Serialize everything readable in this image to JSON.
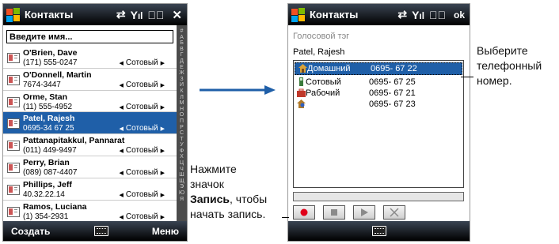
{
  "left_screen": {
    "title": "Контакты",
    "search_placeholder": "Введите имя...",
    "alpha_index": "#АБВГДЕЖЗИКЛМНОПРСТУФХЦЧШЩЭЮЯ",
    "contacts": [
      {
        "name": "O'Brien, Dave",
        "phone": "(171) 555-0247",
        "type": "Сотовый",
        "selected": false
      },
      {
        "name": "O'Donnell, Martin",
        "phone": "7674-3447",
        "type": "Сотовый",
        "selected": false
      },
      {
        "name": "Orme, Stan",
        "phone": "(11) 555-4952",
        "type": "Сотовый",
        "selected": false
      },
      {
        "name": "Patel, Rajesh",
        "phone": "0695-34 67 25",
        "type": "Сотовый",
        "selected": true
      },
      {
        "name": "Pattanapitakkul, Pannarat",
        "phone": "(011) 449-9497",
        "type": "Сотовый",
        "selected": false
      },
      {
        "name": "Perry, Brian",
        "phone": "(089) 087-4407",
        "type": "Сотовый",
        "selected": false
      },
      {
        "name": "Phillips, Jeff",
        "phone": "40.32.22.14",
        "type": "Сотовый",
        "selected": false
      },
      {
        "name": "Ramos, Luciana",
        "phone": "(1) 354-2931",
        "type": "Сотовый",
        "selected": false
      }
    ],
    "left_softkey": "Создать",
    "right_softkey": "Меню"
  },
  "right_screen": {
    "title": "Контакты",
    "ok_label": "ok",
    "voice_tag_label": "Голосовой тэг",
    "contact_name": "Patel, Rajesh",
    "numbers": [
      {
        "label": "Домашний",
        "number": "0695- 67 22",
        "icon": "home-icon",
        "selected": true
      },
      {
        "label": "Сотовый",
        "number": "0695- 67 25",
        "icon": "mobile-icon",
        "selected": false
      },
      {
        "label": "Рабочий",
        "number": "0695- 67 21",
        "icon": "work-icon",
        "selected": false
      },
      {
        "label": "",
        "number": "0695- 67 23",
        "icon": "home-other-icon",
        "selected": false
      }
    ]
  },
  "annotations": {
    "select_number": "Выберите телефонный номер.",
    "press_line1": "Нажмите",
    "press_line2": "значок",
    "press_bold": "Запись",
    "press_rest": ", чтобы",
    "press_line4": "начать запись."
  },
  "colors": {
    "selection": "#1f5fa8",
    "record": "#e0001a",
    "titlebar": "#000000"
  }
}
